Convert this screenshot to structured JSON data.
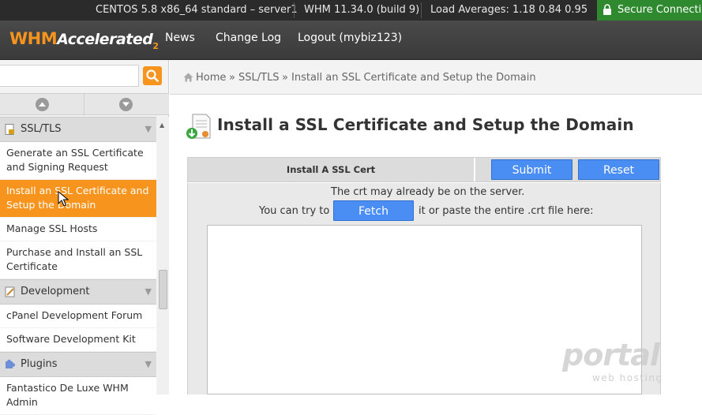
{
  "statusbar": {
    "os": "CENTOS 5.8 x86_64 standard – server1",
    "version": "WHM 11.34.0 (build 9)",
    "load": "Load Averages: 1.18 0.84 0.95",
    "secure": "Secure Connection",
    "secure_color": "#2f8a2f"
  },
  "header": {
    "logo_whm": "WHM",
    "logo_accelerated": "Accelerated",
    "logo_two": "2",
    "nav": [
      "News",
      "Change Log",
      "Logout (mybiz123)"
    ]
  },
  "sidebar": {
    "search_placeholder": "",
    "categories": [
      {
        "label": "SSL/TLS",
        "icon": "document-lock-icon"
      },
      {
        "label": "Development",
        "icon": "pencil-note-icon"
      },
      {
        "label": "Plugins",
        "icon": "puzzle-icon"
      }
    ],
    "ssl_items": [
      "Generate an SSL Certificate and Signing Request",
      "Install an SSL Certificate and Setup the Domain",
      "Manage SSL Hosts",
      "Purchase and Install an SSL Certificate"
    ],
    "dev_items": [
      "cPanel Development Forum",
      "Software Development Kit"
    ],
    "plugin_items": [
      "Fantastico De Luxe WHM Admin"
    ]
  },
  "breadcrumb": {
    "home": "Home",
    "sep": "»",
    "section": "SSL/TLS",
    "current": "Install an SSL Certificate and Setup the Domain"
  },
  "main": {
    "title": "Install a SSL Certificate and Setup the Domain",
    "panel_label": "Install A SSL Cert",
    "submit": "Submit",
    "reset": "Reset",
    "line1": "The crt may already be on the server.",
    "line2_before": "You can try to",
    "fetch": "Fetch",
    "line2_after": "it or paste the entire .crt file here:",
    "crt_value": ""
  },
  "watermark": {
    "main": "portal",
    "sub": "web hosting"
  },
  "colors": {
    "accent": "#f7941d",
    "button": "#4b8ef3",
    "header": "#3f3f3f"
  }
}
